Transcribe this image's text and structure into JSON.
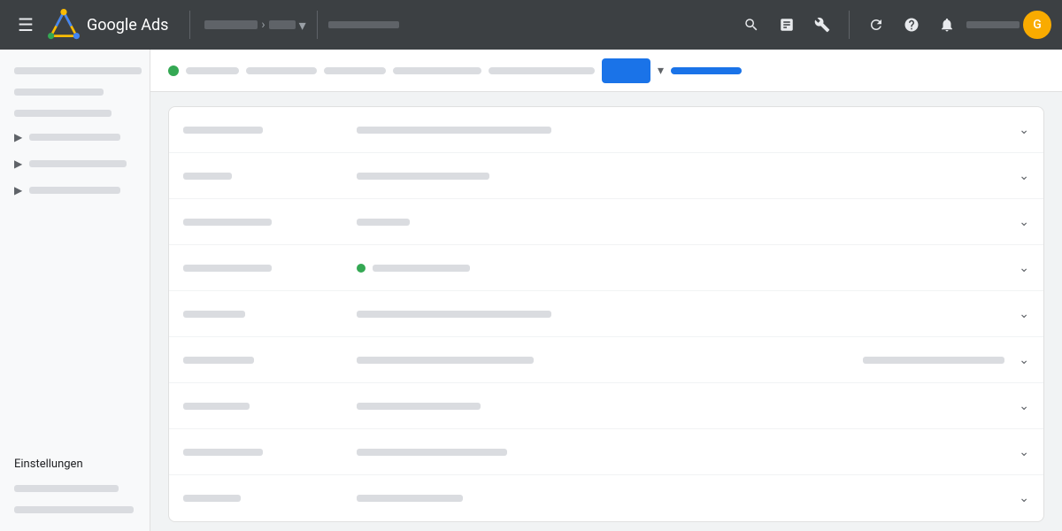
{
  "topnav": {
    "menu_label": "☰",
    "title": "Google Ads",
    "breadcrumb_widths": [
      60,
      30
    ],
    "nav_secondary_width": 80,
    "icons": [
      "search",
      "bar-chart",
      "wrench",
      "refresh",
      "help",
      "bell"
    ],
    "account_bar_width": 60,
    "avatar_letter": "G"
  },
  "subnav": {
    "pills": [
      60,
      80,
      70,
      100,
      120
    ],
    "active_label": "",
    "dropdown_width": 80
  },
  "sidebar": {
    "lines": [
      {
        "width": "85%"
      },
      {
        "width": "60%"
      }
    ],
    "items": [
      {
        "label": "",
        "width": "80%",
        "has_chevron": false
      },
      {
        "label": "",
        "width": "75%",
        "has_chevron": true
      },
      {
        "label": "",
        "width": "80%",
        "has_chevron": true
      },
      {
        "label": "",
        "width": "75%",
        "has_chevron": true
      }
    ],
    "settings_label": "Einstellungen",
    "bottom_lines": [
      {
        "width": "70%"
      },
      {
        "width": "80%"
      }
    ]
  },
  "table": {
    "rows": [
      {
        "col1_width": 90,
        "col2_width": 220,
        "col3_width": 0,
        "has_dot": false
      },
      {
        "col1_width": 55,
        "col2_width": 150,
        "col3_width": 0,
        "has_dot": false
      },
      {
        "col1_width": 100,
        "col2_width": 60,
        "col3_width": 0,
        "has_dot": false
      },
      {
        "col1_width": 100,
        "col2_width": 140,
        "col3_width": 0,
        "has_dot": true
      },
      {
        "col1_width": 70,
        "col2_width": 220,
        "col3_width": 0,
        "has_dot": false
      },
      {
        "col1_width": 80,
        "col2_width": 200,
        "col3_width": 160,
        "has_dot": false
      },
      {
        "col1_width": 75,
        "col2_width": 140,
        "col3_width": 0,
        "has_dot": false
      },
      {
        "col1_width": 90,
        "col2_width": 170,
        "col3_width": 0,
        "has_dot": false
      },
      {
        "col1_width": 65,
        "col2_width": 120,
        "col3_width": 0,
        "has_dot": false
      }
    ]
  }
}
